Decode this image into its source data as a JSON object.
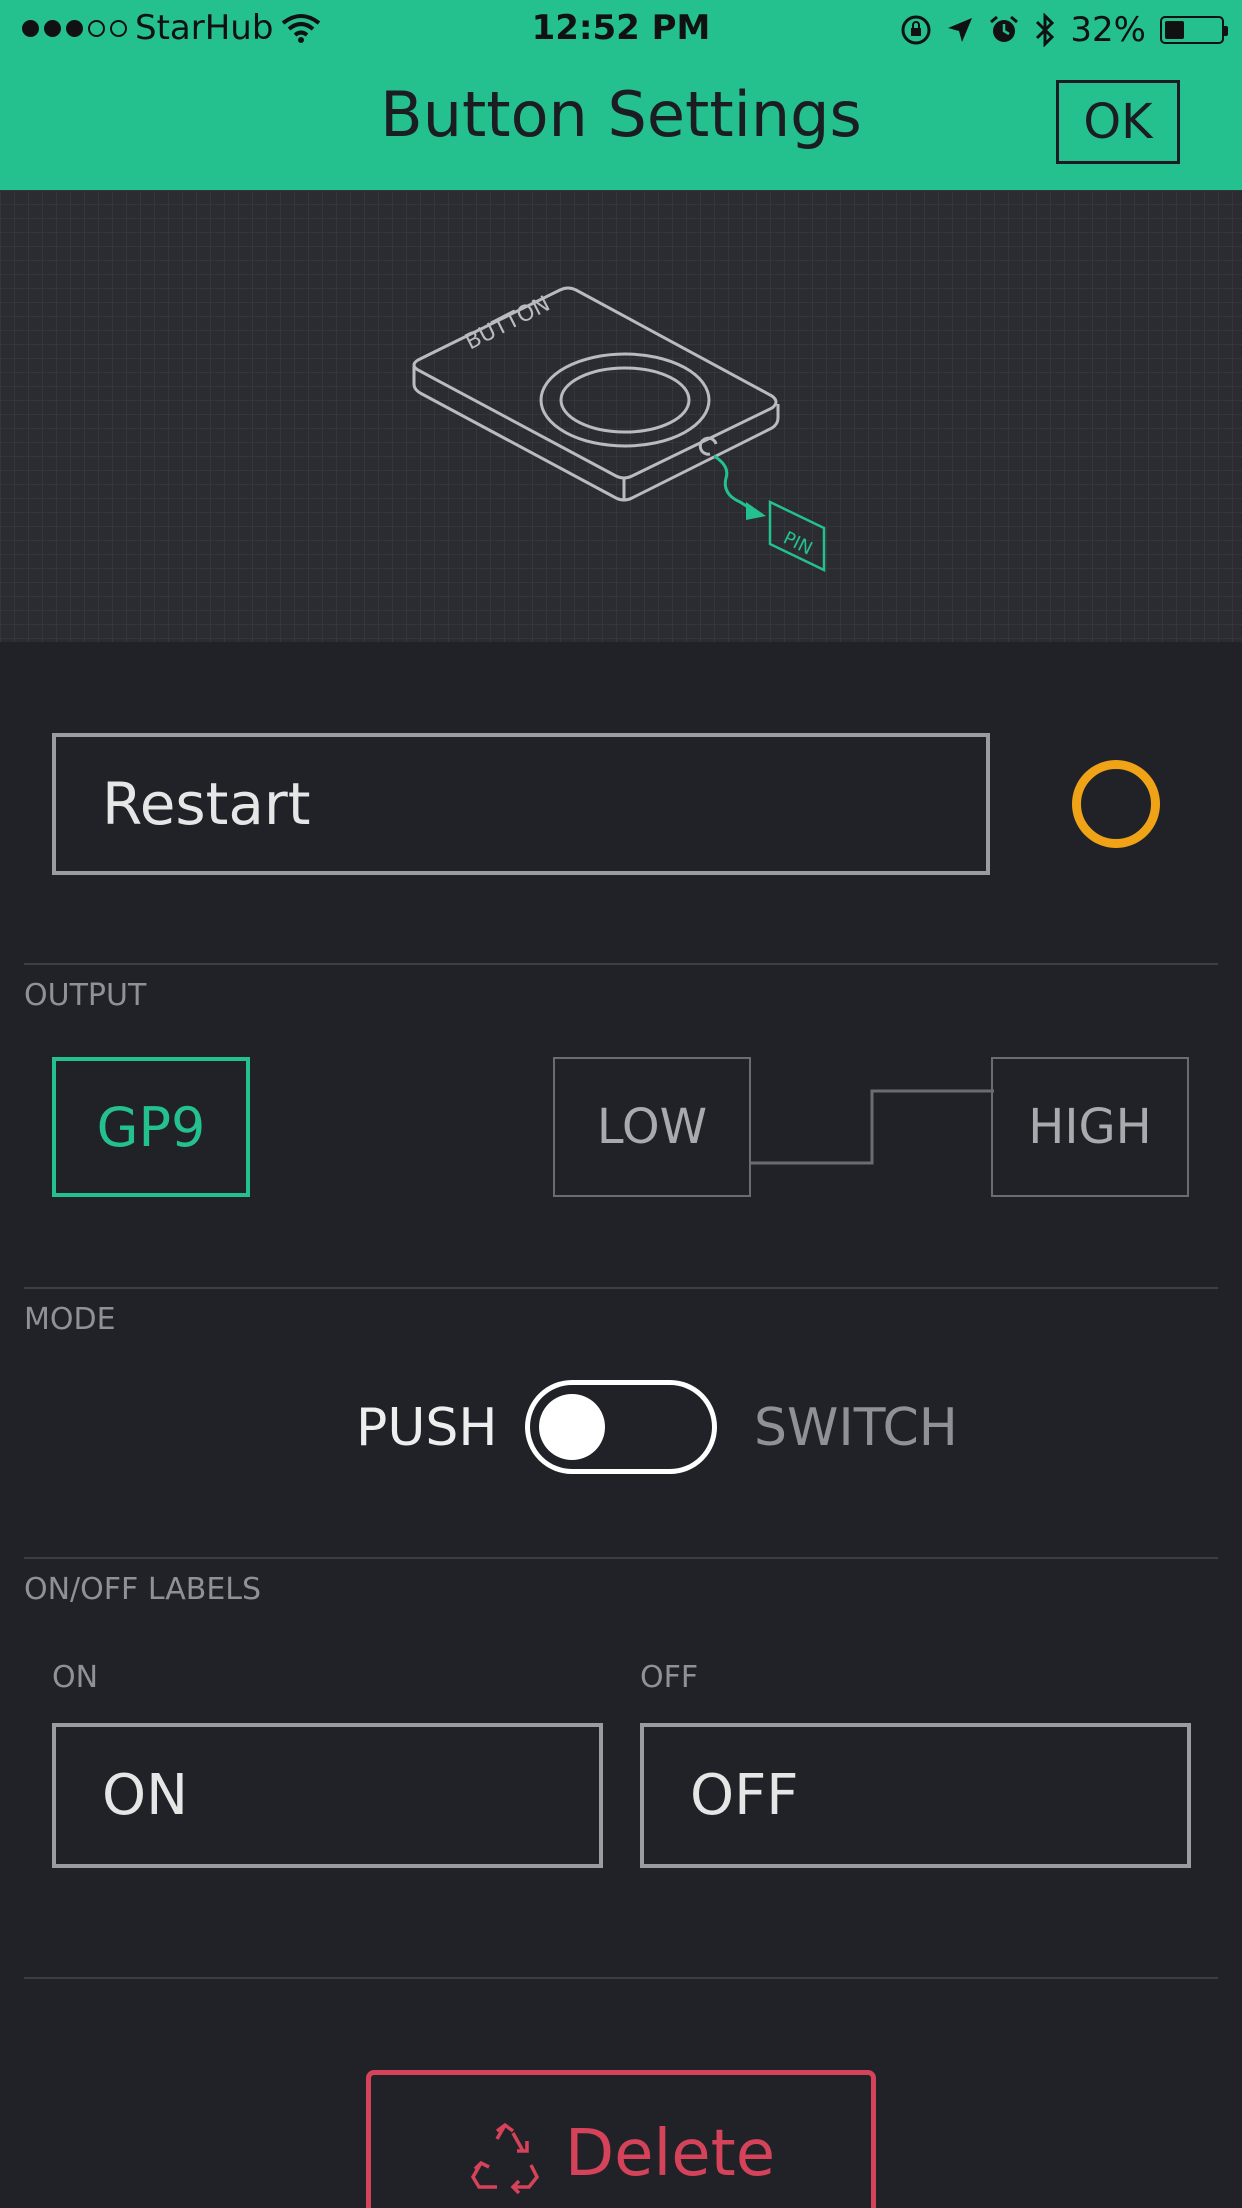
{
  "status_bar": {
    "carrier": "StarHub",
    "time": "12:52 PM",
    "battery": "32%",
    "battery_level": 0.32
  },
  "header": {
    "title": "Button Settings",
    "ok_label": "OK"
  },
  "preview": {
    "device_label": "BUTTON",
    "pin_label": "PIN"
  },
  "name_field": {
    "value": "Restart"
  },
  "widget_color": "#f0a316",
  "accent_color": "#24c18e",
  "output": {
    "section_label": "OUTPUT",
    "pin": "GP9",
    "low_label": "LOW",
    "high_label": "HIGH"
  },
  "mode": {
    "section_label": "MODE",
    "push_label": "PUSH",
    "switch_label": "SWITCH",
    "selected": "PUSH"
  },
  "labels": {
    "section_label": "ON/OFF LABELS",
    "on_caption": "ON",
    "off_caption": "OFF",
    "on_value": "ON",
    "off_value": "OFF"
  },
  "delete": {
    "label": "Delete",
    "color": "#d5435a"
  }
}
